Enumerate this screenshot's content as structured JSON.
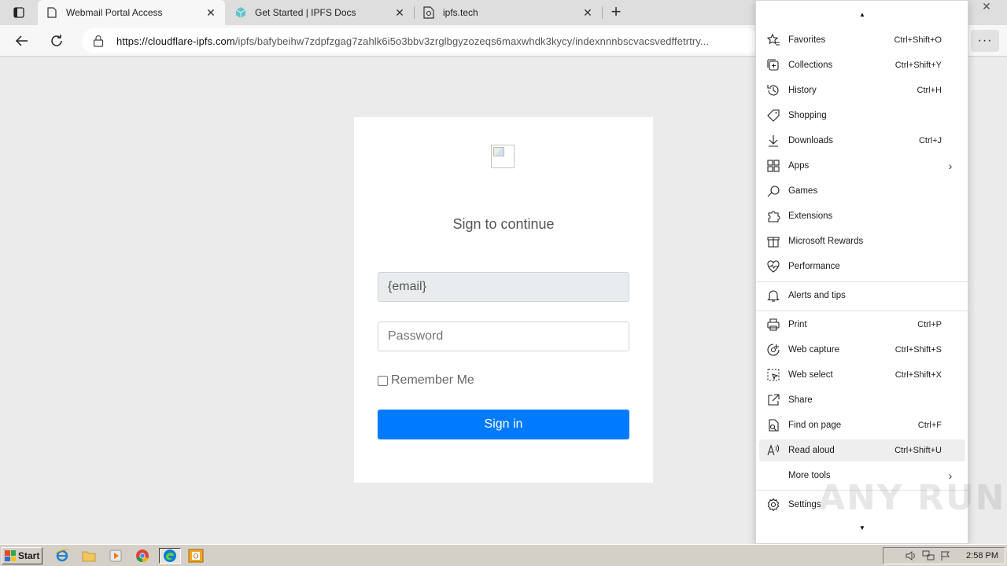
{
  "browser": {
    "tabs": [
      {
        "title": "Webmail Portal Access",
        "icon": "page-icon",
        "active": true
      },
      {
        "title": "Get Started | IPFS Docs",
        "icon": "ipfs-cube-icon",
        "active": false
      },
      {
        "title": "ipfs.tech",
        "icon": "ipfs-page-icon",
        "active": false
      }
    ],
    "address": {
      "host": "https://cloudflare-ipfs.com",
      "path": "/ipfs/bafybeihw7zdpfzgag7zahlk6i5o3bbv3zrglbgyzozeqs6maxwhdk3kycy/indexnnnbscvacsvedffetrtry..."
    }
  },
  "page": {
    "heading": "Sign to continue",
    "email_value": "{email}",
    "password_placeholder": "Password",
    "remember_label": "Remember Me",
    "signin_label": "Sign in",
    "primary_color": "#007bff"
  },
  "menu": {
    "items": [
      {
        "label": "Favorites",
        "shortcut": "Ctrl+Shift+O",
        "icon": "star-list-icon"
      },
      {
        "label": "Collections",
        "shortcut": "Ctrl+Shift+Y",
        "icon": "collections-icon"
      },
      {
        "label": "History",
        "shortcut": "Ctrl+H",
        "icon": "history-icon"
      },
      {
        "label": "Shopping",
        "shortcut": "",
        "icon": "tag-icon"
      },
      {
        "label": "Downloads",
        "shortcut": "Ctrl+J",
        "icon": "download-icon"
      },
      {
        "label": "Apps",
        "shortcut": "",
        "icon": "apps-icon"
      },
      {
        "label": "Games",
        "shortcut": "",
        "icon": "games-icon"
      },
      {
        "label": "Extensions",
        "shortcut": "",
        "icon": "puzzle-icon"
      },
      {
        "label": "Microsoft Rewards",
        "shortcut": "",
        "icon": "rewards-icon"
      },
      {
        "label": "Performance",
        "shortcut": "",
        "icon": "heart-pulse-icon"
      },
      {
        "label": "Alerts and tips",
        "shortcut": "",
        "icon": "bell-icon"
      },
      {
        "label": "Print",
        "shortcut": "Ctrl+P",
        "icon": "printer-icon"
      },
      {
        "label": "Web capture",
        "shortcut": "Ctrl+Shift+S",
        "icon": "web-capture-icon"
      },
      {
        "label": "Web select",
        "shortcut": "Ctrl+Shift+X",
        "icon": "web-select-icon"
      },
      {
        "label": "Share",
        "shortcut": "",
        "icon": "share-icon"
      },
      {
        "label": "Find on page",
        "shortcut": "Ctrl+F",
        "icon": "find-icon"
      },
      {
        "label": "Read aloud",
        "shortcut": "Ctrl+Shift+U",
        "icon": "read-aloud-icon"
      },
      {
        "label": "More tools",
        "shortcut": "",
        "icon": ""
      },
      {
        "label": "Settings",
        "shortcut": "",
        "icon": "gear-icon"
      }
    ]
  },
  "watermark": "ANY RUN",
  "taskbar": {
    "start_label": "Start",
    "clock": "2:58 PM"
  }
}
